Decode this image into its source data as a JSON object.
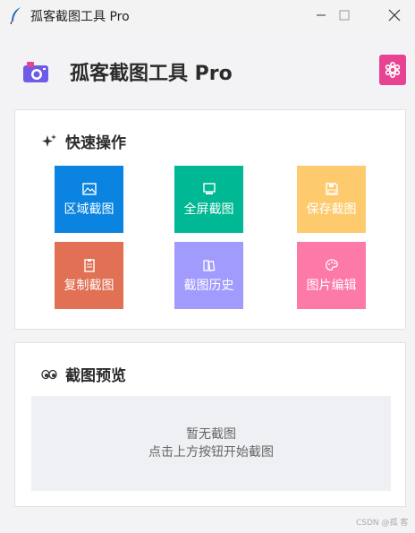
{
  "window": {
    "title": "孤客截图工具 Pro"
  },
  "header": {
    "title": "孤客截图工具 Pro"
  },
  "quick_actions": {
    "title": "快速操作",
    "buttons": [
      {
        "label": "区域截图",
        "color": "#0a84e0",
        "icon": "image-icon"
      },
      {
        "label": "全屏截图",
        "color": "#00b894",
        "icon": "monitor-icon"
      },
      {
        "label": "保存截图",
        "color": "#fdcb6e",
        "icon": "floppy-disk-icon"
      },
      {
        "label": "复制截图",
        "color": "#e17055",
        "icon": "clipboard-icon"
      },
      {
        "label": "截图历史",
        "color": "#a29bfe",
        "icon": "books-icon"
      },
      {
        "label": "图片编辑",
        "color": "#fd79a8",
        "icon": "palette-icon"
      }
    ]
  },
  "preview": {
    "title": "截图预览",
    "empty_line1": "暂无截图",
    "empty_line2": "点击上方按钮开始截图"
  },
  "watermark": "CSDN @孤 客"
}
